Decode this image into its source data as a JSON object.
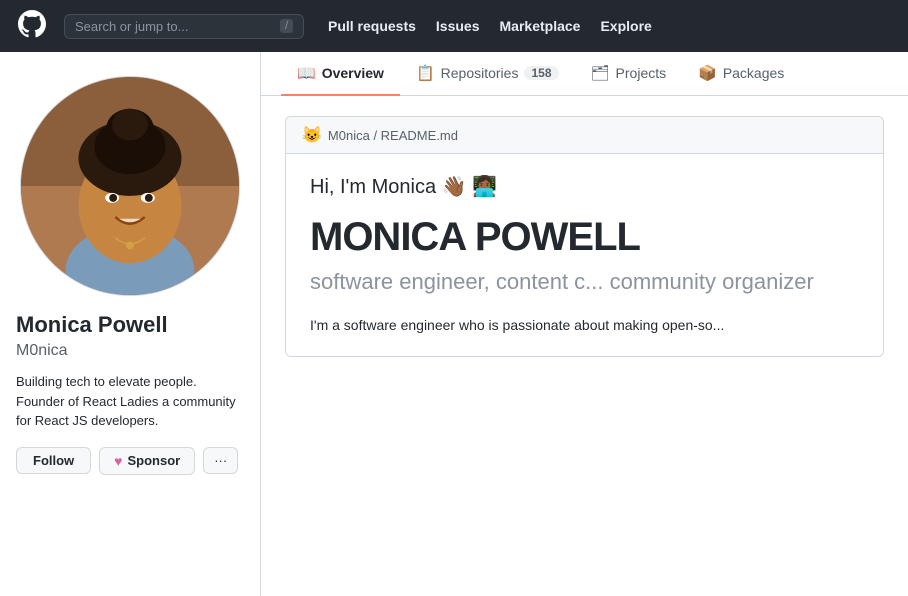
{
  "navbar": {
    "logo_alt": "GitHub",
    "search_placeholder": "Search or jump to...",
    "slash_key": "/",
    "links": [
      {
        "label": "Pull requests",
        "id": "pull-requests"
      },
      {
        "label": "Issues",
        "id": "issues"
      },
      {
        "label": "Marketplace",
        "id": "marketplace"
      },
      {
        "label": "Explore",
        "id": "explore"
      }
    ]
  },
  "tabs": [
    {
      "label": "Overview",
      "icon": "📖",
      "active": true,
      "id": "overview"
    },
    {
      "label": "Repositories",
      "icon": "📋",
      "count": "158",
      "id": "repositories"
    },
    {
      "label": "Projects",
      "icon": "🗂",
      "id": "projects"
    },
    {
      "label": "Packages",
      "icon": "📦",
      "id": "packages"
    }
  ],
  "profile": {
    "name": "Monica Powell",
    "username": "M0nica",
    "bio": "Building tech to elevate people. Founder of React Ladies a community for React JS developers.",
    "buttons": {
      "follow": "Follow",
      "sponsor": "Sponsor",
      "more": "···"
    }
  },
  "readme": {
    "cat_icon": "😺",
    "repo_path": "M0nica / README.md",
    "greeting": "Hi, I'm Monica 👋🏾 👩🏾‍💻",
    "name_big": "MONICA POWELL",
    "tagline": "software engineer, content c... community organizer",
    "intro": "I'm a software engineer who is passionate about making open-so..."
  }
}
